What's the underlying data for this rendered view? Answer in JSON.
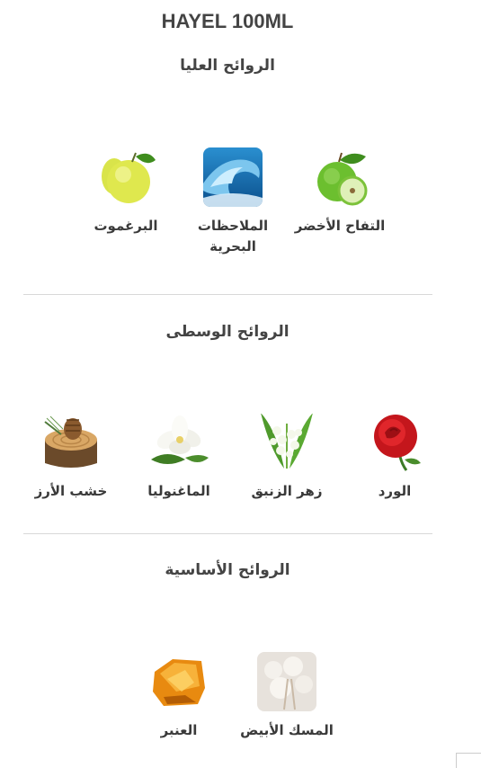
{
  "product_title": "HAYEL 100ML",
  "top_notes": {
    "heading": "الروائح العليا",
    "items": [
      {
        "name": "التفاح الأخضر",
        "icon": "green-apple-icon"
      },
      {
        "name": "الملاحظات البحرية",
        "icon": "ocean-wave-icon"
      },
      {
        "name": "البرغموت",
        "icon": "bergamot-icon"
      }
    ]
  },
  "middle_notes": {
    "heading": "الروائح الوسطى",
    "items": [
      {
        "name": "الورد",
        "icon": "red-rose-icon"
      },
      {
        "name": "زهر الزنبق",
        "icon": "lily-of-the-valley-icon"
      },
      {
        "name": "الماغنوليا",
        "icon": "magnolia-icon"
      },
      {
        "name": "خشب الأرز",
        "icon": "cedarwood-icon"
      }
    ]
  },
  "base_notes": {
    "heading": "الروائح الأساسية",
    "items": [
      {
        "name": "المسك الأبيض",
        "icon": "white-musk-icon"
      },
      {
        "name": "العنبر",
        "icon": "amber-icon"
      }
    ]
  }
}
